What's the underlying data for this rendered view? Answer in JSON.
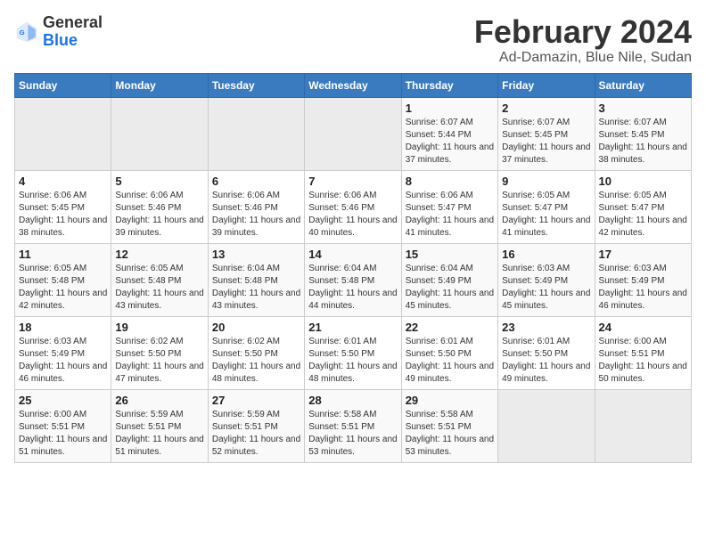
{
  "header": {
    "logo_general": "General",
    "logo_blue": "Blue",
    "title": "February 2024",
    "subtitle": "Ad-Damazin, Blue Nile, Sudan"
  },
  "calendar": {
    "days_of_week": [
      "Sunday",
      "Monday",
      "Tuesday",
      "Wednesday",
      "Thursday",
      "Friday",
      "Saturday"
    ],
    "weeks": [
      [
        {
          "day": "",
          "info": ""
        },
        {
          "day": "",
          "info": ""
        },
        {
          "day": "",
          "info": ""
        },
        {
          "day": "",
          "info": ""
        },
        {
          "day": "1",
          "info": "Sunrise: 6:07 AM\nSunset: 5:44 PM\nDaylight: 11 hours and 37 minutes."
        },
        {
          "day": "2",
          "info": "Sunrise: 6:07 AM\nSunset: 5:45 PM\nDaylight: 11 hours and 37 minutes."
        },
        {
          "day": "3",
          "info": "Sunrise: 6:07 AM\nSunset: 5:45 PM\nDaylight: 11 hours and 38 minutes."
        }
      ],
      [
        {
          "day": "4",
          "info": "Sunrise: 6:06 AM\nSunset: 5:45 PM\nDaylight: 11 hours and 38 minutes."
        },
        {
          "day": "5",
          "info": "Sunrise: 6:06 AM\nSunset: 5:46 PM\nDaylight: 11 hours and 39 minutes."
        },
        {
          "day": "6",
          "info": "Sunrise: 6:06 AM\nSunset: 5:46 PM\nDaylight: 11 hours and 39 minutes."
        },
        {
          "day": "7",
          "info": "Sunrise: 6:06 AM\nSunset: 5:46 PM\nDaylight: 11 hours and 40 minutes."
        },
        {
          "day": "8",
          "info": "Sunrise: 6:06 AM\nSunset: 5:47 PM\nDaylight: 11 hours and 41 minutes."
        },
        {
          "day": "9",
          "info": "Sunrise: 6:05 AM\nSunset: 5:47 PM\nDaylight: 11 hours and 41 minutes."
        },
        {
          "day": "10",
          "info": "Sunrise: 6:05 AM\nSunset: 5:47 PM\nDaylight: 11 hours and 42 minutes."
        }
      ],
      [
        {
          "day": "11",
          "info": "Sunrise: 6:05 AM\nSunset: 5:48 PM\nDaylight: 11 hours and 42 minutes."
        },
        {
          "day": "12",
          "info": "Sunrise: 6:05 AM\nSunset: 5:48 PM\nDaylight: 11 hours and 43 minutes."
        },
        {
          "day": "13",
          "info": "Sunrise: 6:04 AM\nSunset: 5:48 PM\nDaylight: 11 hours and 43 minutes."
        },
        {
          "day": "14",
          "info": "Sunrise: 6:04 AM\nSunset: 5:48 PM\nDaylight: 11 hours and 44 minutes."
        },
        {
          "day": "15",
          "info": "Sunrise: 6:04 AM\nSunset: 5:49 PM\nDaylight: 11 hours and 45 minutes."
        },
        {
          "day": "16",
          "info": "Sunrise: 6:03 AM\nSunset: 5:49 PM\nDaylight: 11 hours and 45 minutes."
        },
        {
          "day": "17",
          "info": "Sunrise: 6:03 AM\nSunset: 5:49 PM\nDaylight: 11 hours and 46 minutes."
        }
      ],
      [
        {
          "day": "18",
          "info": "Sunrise: 6:03 AM\nSunset: 5:49 PM\nDaylight: 11 hours and 46 minutes."
        },
        {
          "day": "19",
          "info": "Sunrise: 6:02 AM\nSunset: 5:50 PM\nDaylight: 11 hours and 47 minutes."
        },
        {
          "day": "20",
          "info": "Sunrise: 6:02 AM\nSunset: 5:50 PM\nDaylight: 11 hours and 48 minutes."
        },
        {
          "day": "21",
          "info": "Sunrise: 6:01 AM\nSunset: 5:50 PM\nDaylight: 11 hours and 48 minutes."
        },
        {
          "day": "22",
          "info": "Sunrise: 6:01 AM\nSunset: 5:50 PM\nDaylight: 11 hours and 49 minutes."
        },
        {
          "day": "23",
          "info": "Sunrise: 6:01 AM\nSunset: 5:50 PM\nDaylight: 11 hours and 49 minutes."
        },
        {
          "day": "24",
          "info": "Sunrise: 6:00 AM\nSunset: 5:51 PM\nDaylight: 11 hours and 50 minutes."
        }
      ],
      [
        {
          "day": "25",
          "info": "Sunrise: 6:00 AM\nSunset: 5:51 PM\nDaylight: 11 hours and 51 minutes."
        },
        {
          "day": "26",
          "info": "Sunrise: 5:59 AM\nSunset: 5:51 PM\nDaylight: 11 hours and 51 minutes."
        },
        {
          "day": "27",
          "info": "Sunrise: 5:59 AM\nSunset: 5:51 PM\nDaylight: 11 hours and 52 minutes."
        },
        {
          "day": "28",
          "info": "Sunrise: 5:58 AM\nSunset: 5:51 PM\nDaylight: 11 hours and 53 minutes."
        },
        {
          "day": "29",
          "info": "Sunrise: 5:58 AM\nSunset: 5:51 PM\nDaylight: 11 hours and 53 minutes."
        },
        {
          "day": "",
          "info": ""
        },
        {
          "day": "",
          "info": ""
        }
      ]
    ]
  }
}
